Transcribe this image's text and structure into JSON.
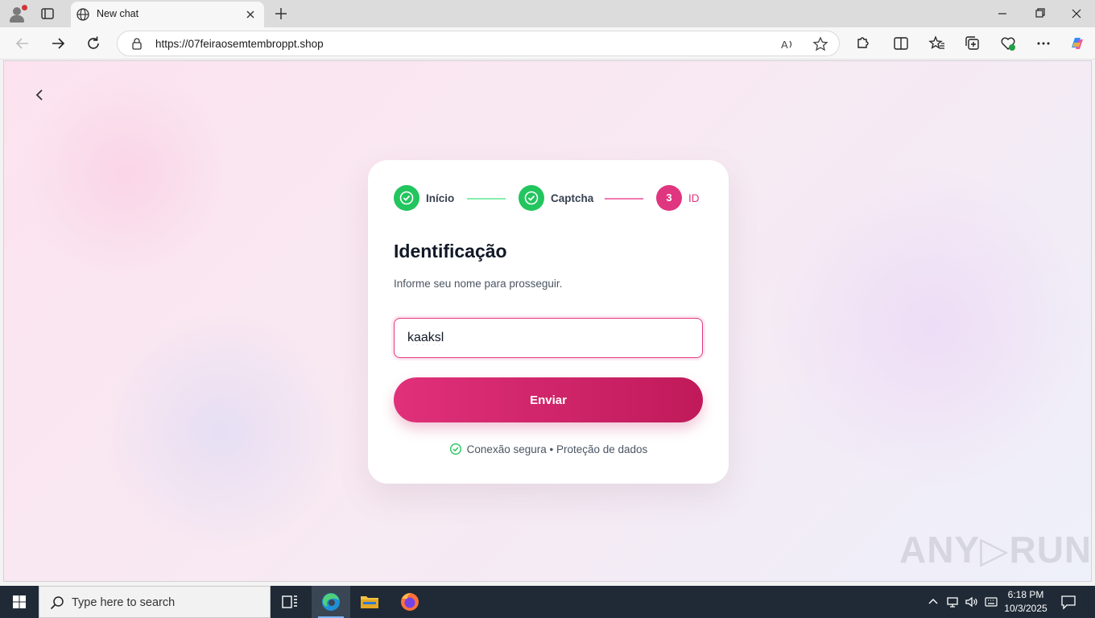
{
  "browser": {
    "tab_title": "New chat",
    "url": "https://07feiraosemtembroppt.shop"
  },
  "stepper": {
    "steps": [
      {
        "label": "Início",
        "status": "done"
      },
      {
        "label": "Captcha",
        "status": "done"
      },
      {
        "number": "3",
        "label": "ID",
        "status": "active"
      }
    ]
  },
  "form": {
    "title": "Identificação",
    "subtitle": "Informe seu nome para prosseguir.",
    "name_value": "kaaksl",
    "submit_label": "Enviar",
    "secure_note": "Conexão segura • Proteção de dados"
  },
  "watermark": "ANY▷RUN",
  "taskbar": {
    "search_placeholder": "Type here to search",
    "time": "6:18 PM",
    "date": "10/3/2025"
  },
  "colors": {
    "accent": "#e0357f",
    "success": "#22c55e",
    "button_gradient_start": "#e0307a",
    "button_gradient_end": "#c01a5a"
  },
  "icons": {
    "tab": "globe-icon",
    "nav": [
      "back-arrow-icon",
      "forward-arrow-icon",
      "refresh-icon"
    ],
    "toolbar": [
      "extensions-icon",
      "split-screen-icon",
      "favorites-icon",
      "collections-icon",
      "browser-essentials-icon",
      "more-icon",
      "copilot-icon"
    ]
  }
}
